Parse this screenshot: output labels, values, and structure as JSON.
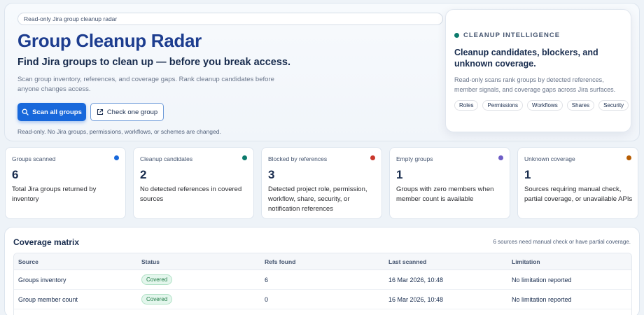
{
  "hero": {
    "tag": "Read-only Jira group cleanup radar",
    "title": "Group Cleanup Radar",
    "subtitle": "Find Jira groups to clean up — before you break access.",
    "description": "Scan group inventory, references, and coverage gaps. Rank cleanup candidates before anyone changes access.",
    "scan_button": "Scan all groups",
    "check_button": "Check one group",
    "note": "Read-only. No Jira groups, permissions, workflows, or schemes are changed."
  },
  "intel": {
    "heading": "CLEANUP INTELLIGENCE",
    "title": "Cleanup candidates, blockers, and unknown coverage.",
    "description": "Read-only scans rank groups by detected references, member signals, and coverage gaps across Jira surfaces.",
    "chips": [
      "Roles",
      "Permissions",
      "Workflows",
      "Shares",
      "Security"
    ],
    "accent": "#0b7a6c"
  },
  "stats": [
    {
      "label": "Groups scanned",
      "value": "6",
      "desc": "Total Jira groups returned by inventory",
      "color": "#1868db"
    },
    {
      "label": "Cleanup candidates",
      "value": "2",
      "desc": "No detected references in covered sources",
      "color": "#0b7a6c"
    },
    {
      "label": "Blocked by references",
      "value": "3",
      "desc": "Detected project role, permission, workflow, share, security, or notification references",
      "color": "#c9372c"
    },
    {
      "label": "Empty groups",
      "value": "1",
      "desc": "Groups with zero members when member count is available",
      "color": "#6e5dc6"
    },
    {
      "label": "Unknown coverage",
      "value": "1",
      "desc": "Sources requiring manual check, partial coverage, or unavailable APIs",
      "color": "#b65c02"
    }
  ],
  "coverage": {
    "title": "Coverage matrix",
    "note": "6 sources need manual check or have partial coverage.",
    "columns": [
      "Source",
      "Status",
      "Refs found",
      "Last scanned",
      "Limitation"
    ],
    "rows": [
      {
        "source": "Groups inventory",
        "status": "Covered",
        "refs": "6",
        "last": "16 Mar 2026, 10:48",
        "limitation": "No limitation reported"
      },
      {
        "source": "Group member count",
        "status": "Covered",
        "refs": "0",
        "last": "16 Mar 2026, 10:48",
        "limitation": "No limitation reported"
      }
    ]
  }
}
